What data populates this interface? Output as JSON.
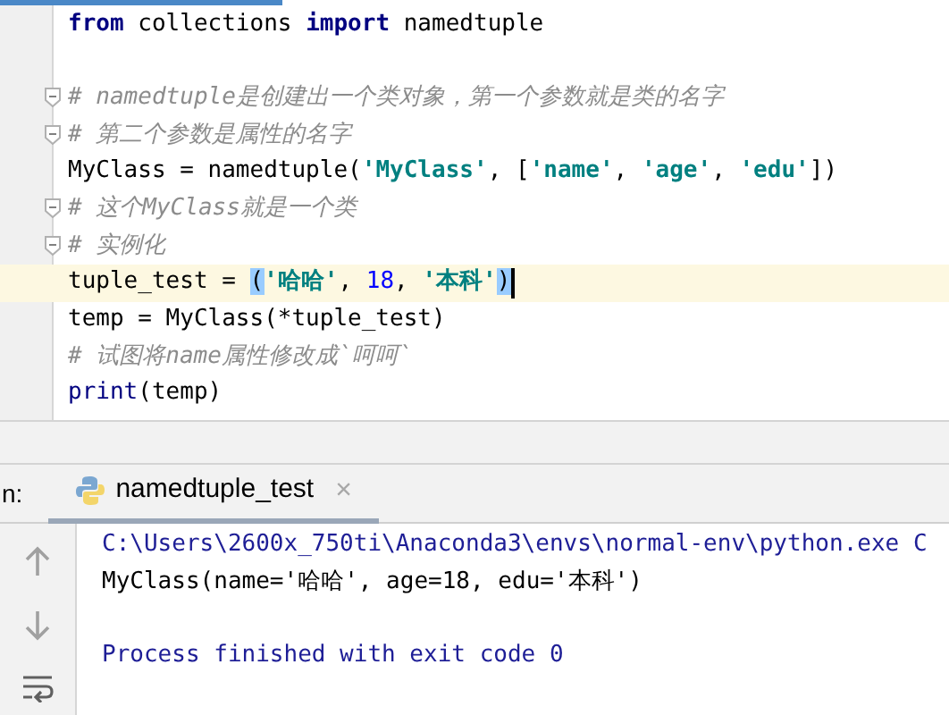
{
  "editor": {
    "lines": [
      {
        "tokens": [
          {
            "kind": "keyword",
            "text": "from"
          },
          {
            "kind": "plain",
            "text": " collections "
          },
          {
            "kind": "keyword",
            "text": "import"
          },
          {
            "kind": "plain",
            "text": " namedtuple"
          }
        ]
      },
      {
        "fold": true,
        "blank_before": true,
        "tokens": [
          {
            "kind": "comment",
            "text": "# namedtuple是创建出一个类对象，第一个参数就是类的名字"
          }
        ]
      },
      {
        "fold": true,
        "tokens": [
          {
            "kind": "comment",
            "text": "# 第二个参数是属性的名字"
          }
        ]
      },
      {
        "tokens": [
          {
            "kind": "plain",
            "text": "MyClass = namedtuple("
          },
          {
            "kind": "string",
            "text": "'MyClass'"
          },
          {
            "kind": "plain",
            "text": ", ["
          },
          {
            "kind": "string",
            "text": "'name'"
          },
          {
            "kind": "plain",
            "text": ", "
          },
          {
            "kind": "string",
            "text": "'age'"
          },
          {
            "kind": "plain",
            "text": ", "
          },
          {
            "kind": "string",
            "text": "'edu'"
          },
          {
            "kind": "plain",
            "text": "])"
          }
        ]
      },
      {
        "fold": true,
        "tokens": [
          {
            "kind": "comment",
            "text": "# 这个MyClass就是一个类"
          }
        ]
      },
      {
        "fold": true,
        "tokens": [
          {
            "kind": "comment",
            "text": "# 实例化"
          }
        ]
      },
      {
        "current": true,
        "tokens": [
          {
            "kind": "plain",
            "text": "tuple_test = "
          },
          {
            "kind": "match",
            "text": "("
          },
          {
            "kind": "string",
            "text": "'哈哈'"
          },
          {
            "kind": "plain",
            "text": ", "
          },
          {
            "kind": "number",
            "text": "18"
          },
          {
            "kind": "plain",
            "text": ", "
          },
          {
            "kind": "string",
            "text": "'本科'"
          },
          {
            "kind": "match",
            "text": ")"
          }
        ]
      },
      {
        "tokens": [
          {
            "kind": "plain",
            "text": "temp = MyClass(*tuple_test)"
          }
        ]
      },
      {
        "tokens": [
          {
            "kind": "comment",
            "text": "# 试图将name属性修改成`呵呵`"
          }
        ]
      },
      {
        "tokens": [
          {
            "kind": "builtin",
            "text": "print"
          },
          {
            "kind": "plain",
            "text": "(temp)"
          }
        ]
      }
    ]
  },
  "run_panel": {
    "label": "n:",
    "tab": {
      "title": "namedtuple_test",
      "close": "×",
      "selected": true
    },
    "console": [
      {
        "kind": "system",
        "text": "C:\\Users\\2600x_750ti\\Anaconda3\\envs\\normal-env\\python.exe C",
        "blank_before": false
      },
      {
        "kind": "stdout",
        "text": "MyClass(name='哈哈', age=18, edu='本科')",
        "blank_before": false
      },
      {
        "kind": "system",
        "text": "Process finished with exit code 0",
        "blank_before": true
      }
    ]
  }
}
